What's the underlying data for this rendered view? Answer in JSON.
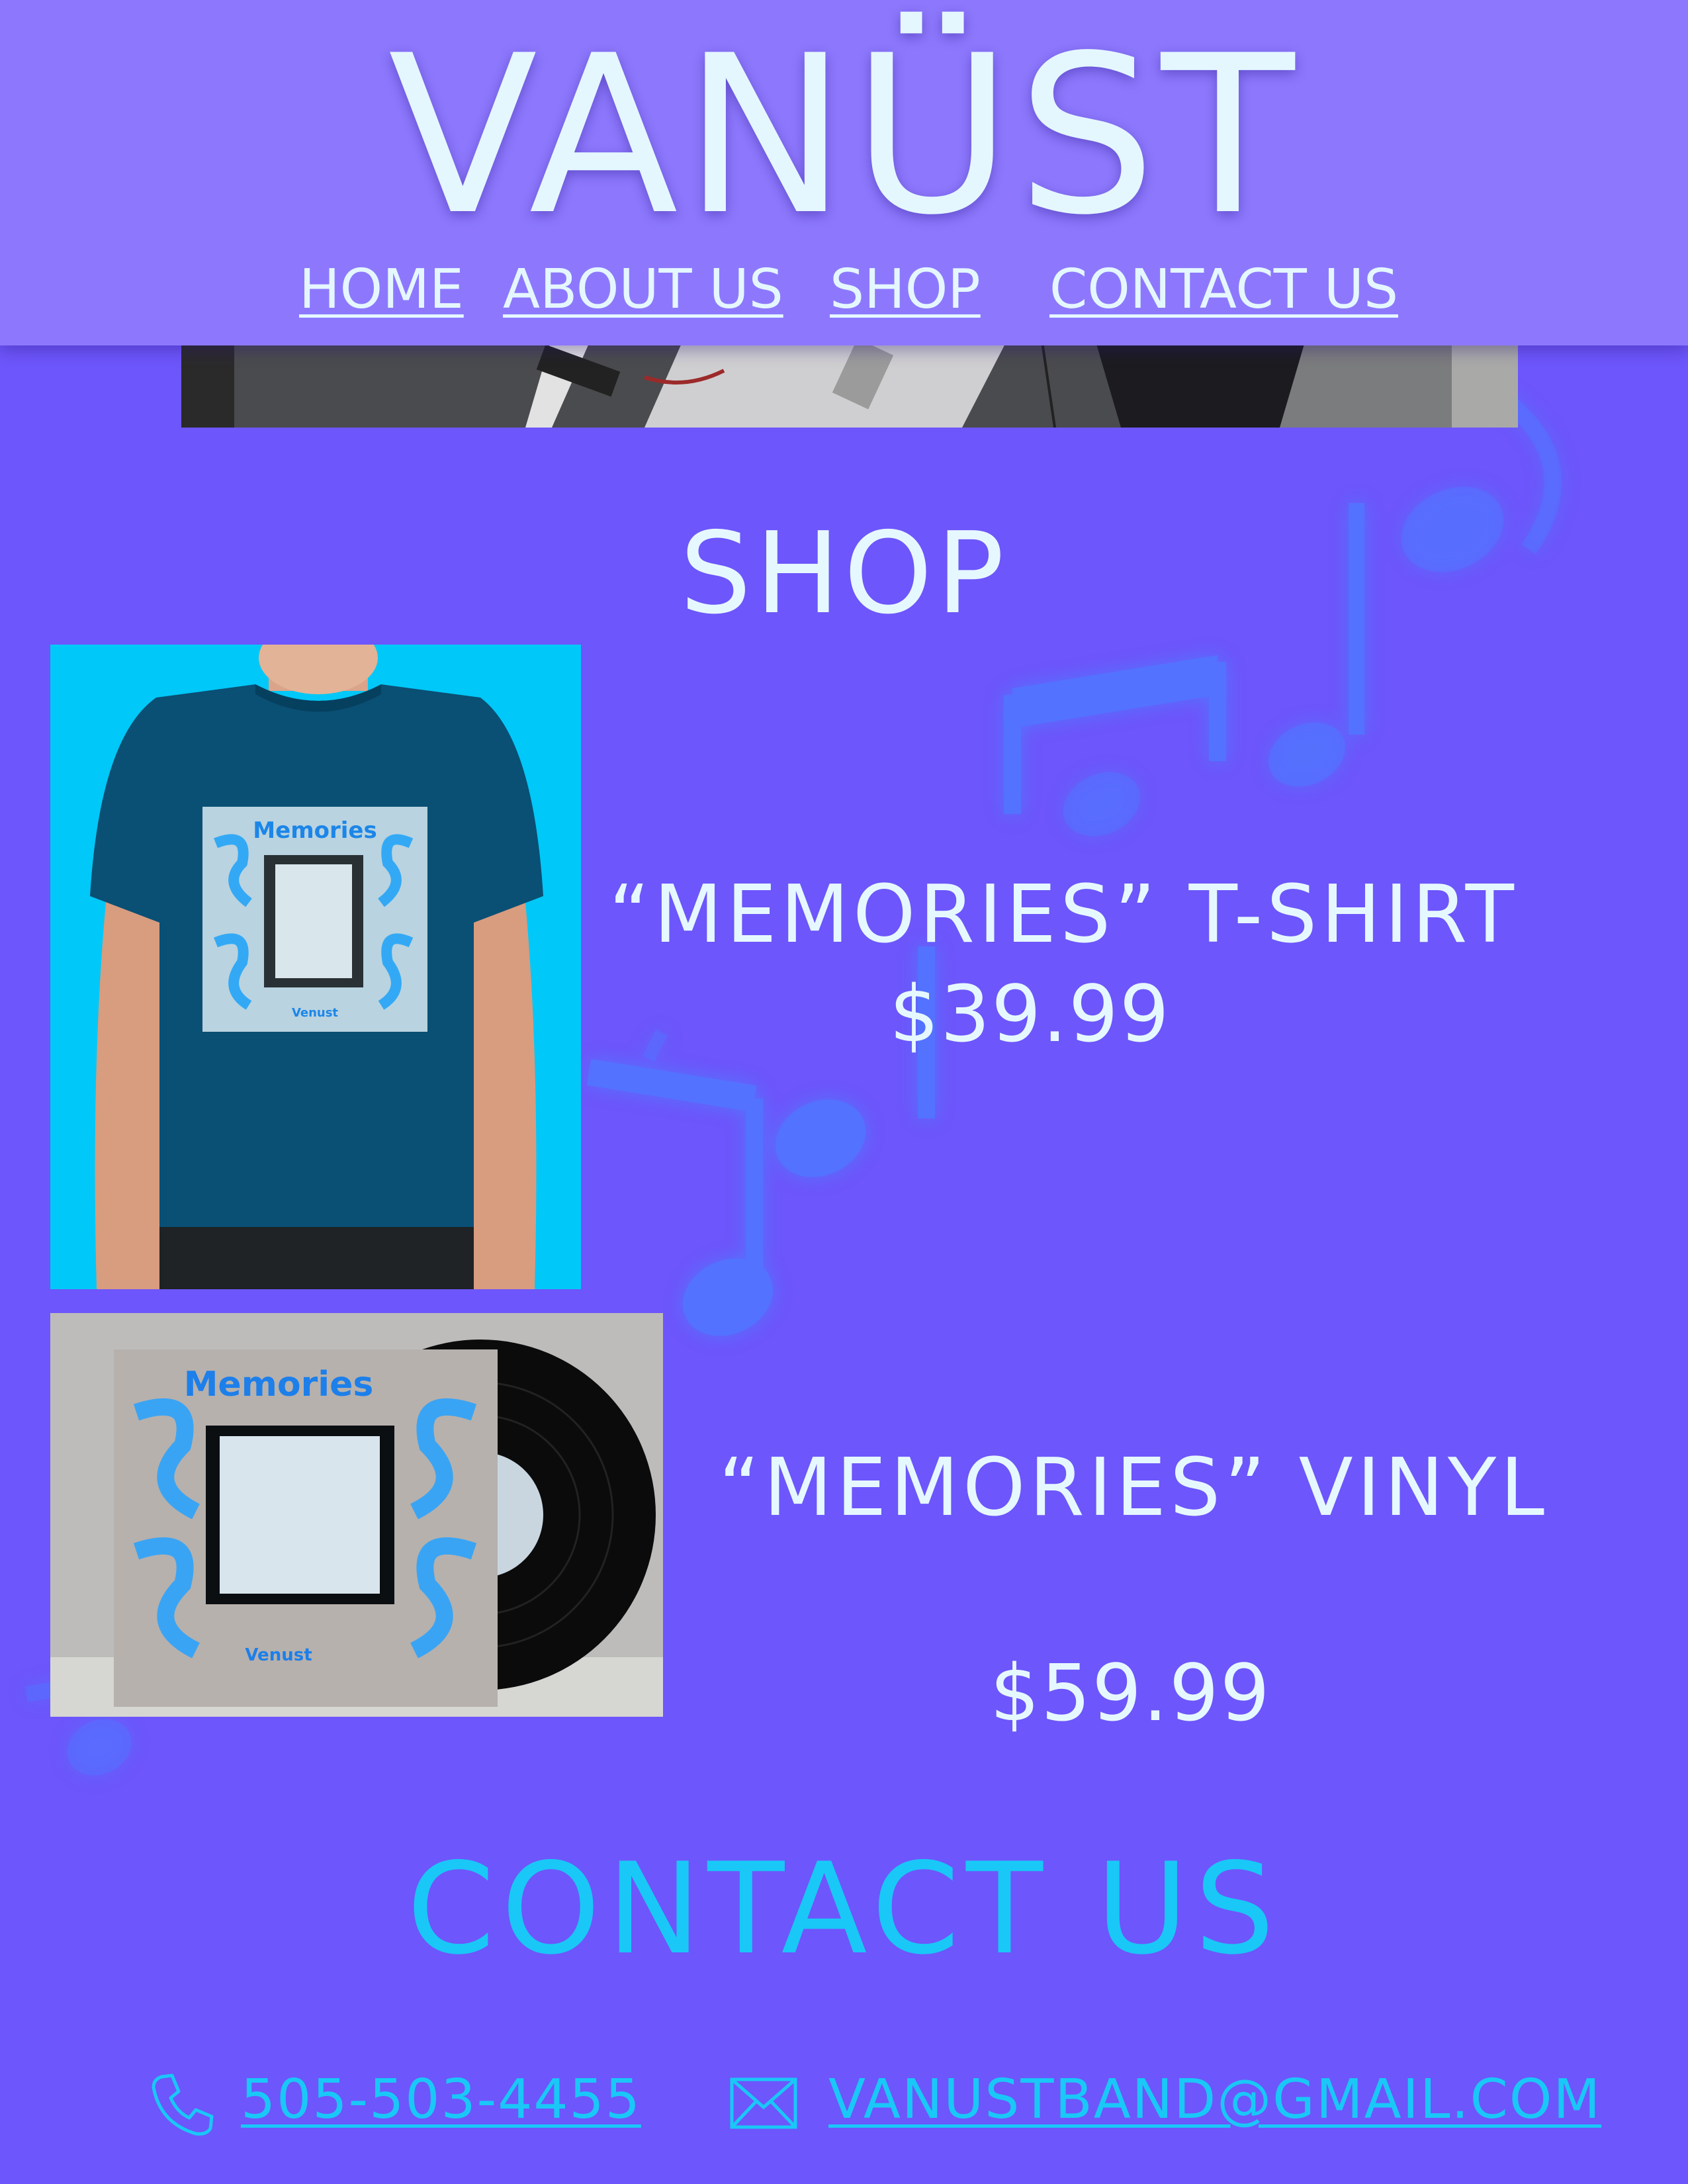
{
  "header": {
    "brand": "VANÜST",
    "nav": [
      {
        "label": "HOME"
      },
      {
        "label": "ABOUT US"
      },
      {
        "label": "SHOP"
      },
      {
        "label": "CONTACT US"
      }
    ]
  },
  "shop": {
    "title": "SHOP",
    "products": [
      {
        "name": "“MEMORIES” T-SHIRT",
        "price": "$39.99",
        "image": "memories-tshirt-photo"
      },
      {
        "name": "“MEMORIES” VINYL",
        "price": "$59.99",
        "image": "memories-vinyl-photo"
      }
    ],
    "album_art": {
      "title": "Memories",
      "artist": "Venust"
    }
  },
  "contact": {
    "title": "CONTACT US",
    "phone": "505-503-4455",
    "email": "VANUSTBAND@GMAIL.COM",
    "phone_icon": "phone-icon",
    "email_icon": "mail-icon"
  },
  "colors": {
    "background": "#6d56fb",
    "header": "#8d78fd",
    "text_light": "#e4f7ff",
    "accent_cyan": "#19c8f7",
    "note_blue": "#4d7cff"
  }
}
